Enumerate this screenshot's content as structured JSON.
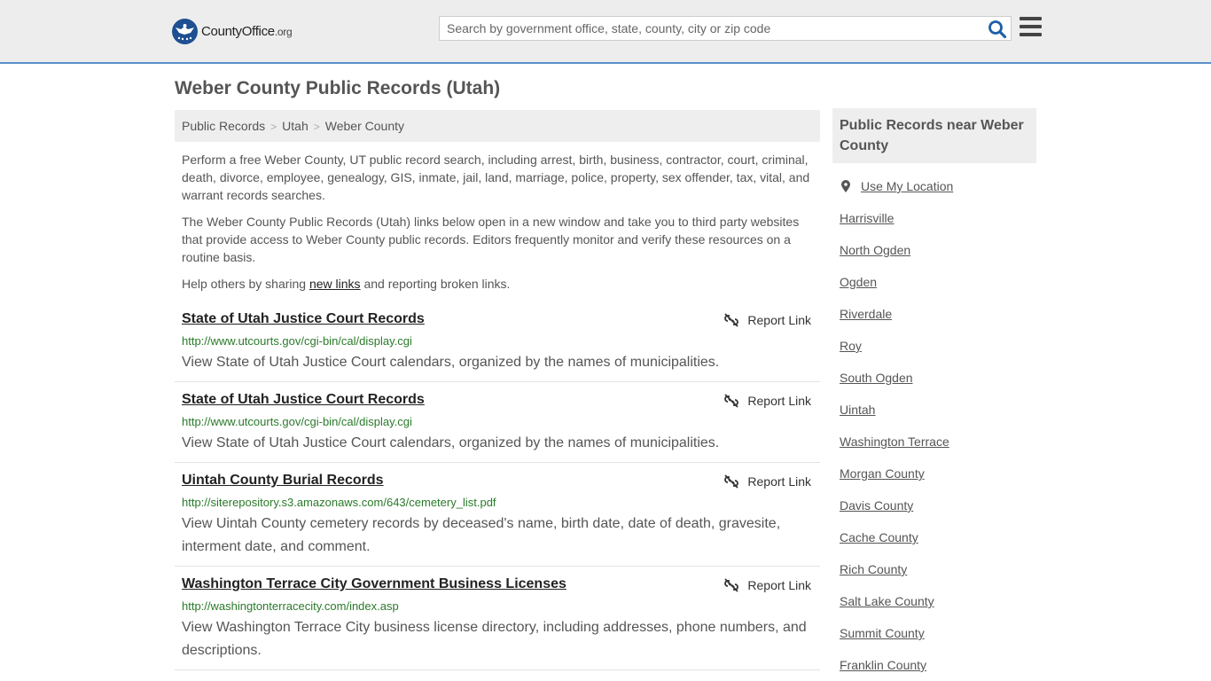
{
  "header": {
    "logo_main": "CountyOffice",
    "logo_org": ".org",
    "search_placeholder": "Search by government office, state, county, city or zip code"
  },
  "page_title": "Weber County Public Records (Utah)",
  "breadcrumb": [
    "Public Records",
    "Utah",
    "Weber County"
  ],
  "intro": {
    "p1": "Perform a free Weber County, UT public record search, including arrest, birth, business, contractor, court, criminal, death, divorce, employee, genealogy, GIS, inmate, jail, land, marriage, police, property, sex offender, tax, vital, and warrant records searches.",
    "p2": "The Weber County Public Records (Utah) links below open in a new window and take you to third party websites that provide access to Weber County public records. Editors frequently monitor and verify these resources on a routine basis.",
    "p3_before": "Help others by sharing ",
    "p3_link": "new links",
    "p3_after": " and reporting broken links."
  },
  "report_label": "Report Link",
  "records": [
    {
      "title": "State of Utah Justice Court Records",
      "url": "http://www.utcourts.gov/cgi-bin/cal/display.cgi",
      "desc": "View State of Utah Justice Court calendars, organized by the names of municipalities."
    },
    {
      "title": "State of Utah Justice Court Records",
      "url": "http://www.utcourts.gov/cgi-bin/cal/display.cgi",
      "desc": "View State of Utah Justice Court calendars, organized by the names of municipalities."
    },
    {
      "title": "Uintah County Burial Records",
      "url": "http://siterepository.s3.amazonaws.com/643/cemetery_list.pdf",
      "desc": "View Uintah County cemetery records by deceased's name, birth date, date of death, gravesite, interment date, and comment."
    },
    {
      "title": "Washington Terrace City Government Business Licenses",
      "url": "http://washingtonterracecity.com/index.asp",
      "desc": "View Washington Terrace City business license directory, including addresses, phone numbers, and descriptions."
    }
  ],
  "sidebar": {
    "heading": "Public Records near Weber County",
    "use_location": "Use My Location",
    "links": [
      "Harrisville",
      "North Ogden",
      "Ogden",
      "Riverdale",
      "Roy",
      "South Ogden",
      "Uintah",
      "Washington Terrace",
      "Morgan County",
      "Davis County",
      "Cache County",
      "Rich County",
      "Salt Lake County",
      "Summit County",
      "Franklin County"
    ]
  }
}
